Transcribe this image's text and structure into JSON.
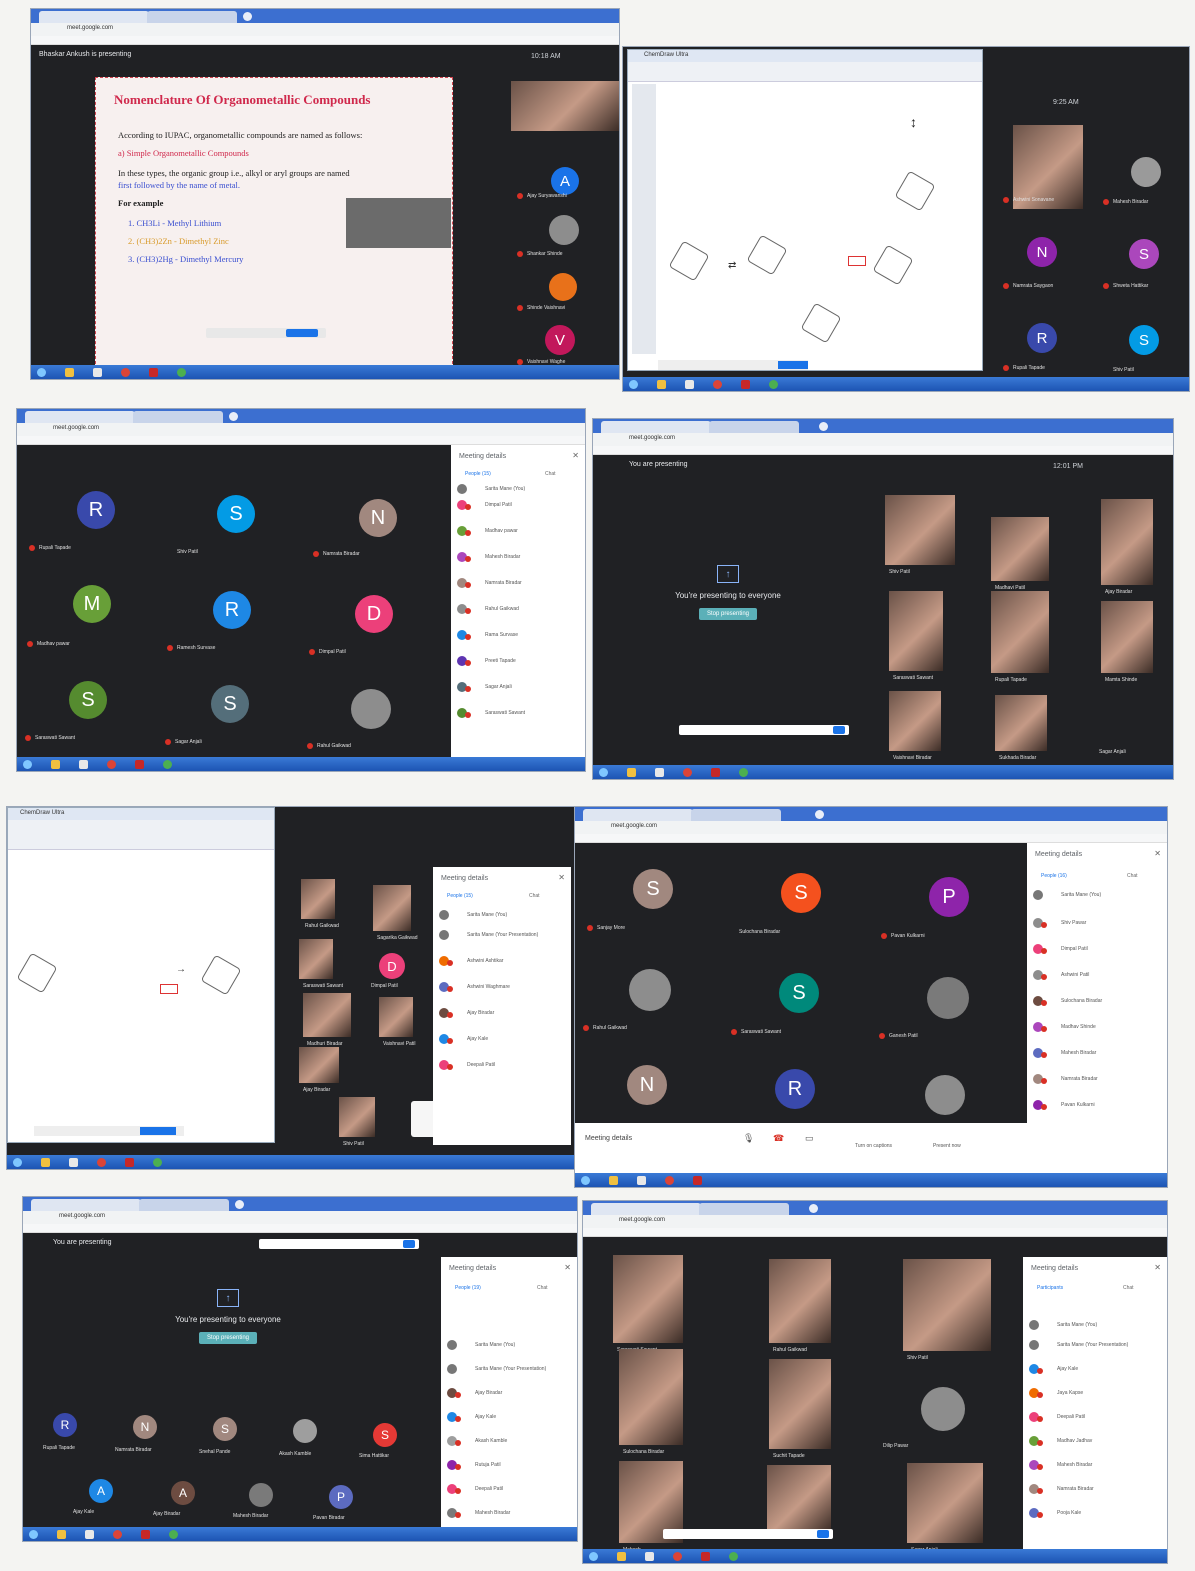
{
  "screens": [
    {
      "url": "meet.google.com",
      "banner": "Bhaskar Ankush is presenting",
      "clock": "10:18 AM",
      "slide": {
        "title": "Nomenclature Of Organometallic Compounds",
        "line1": "According to IUPAC, organometallic compounds are named as follows:",
        "line2": "a) Simple Organometallic Compounds",
        "line3": "In these types, the organic group i.e., alkyl or aryl groups are named",
        "line4": "first followed by the name of metal.",
        "line5": "For example",
        "ex1": "1.  CH3Li   - Methyl Lithium",
        "ex2": "2.  (CH3)2Zn  - Dimethyl Zinc",
        "ex3": "3.  (CH3)2Hg  - Dimethyl Mercury"
      },
      "participants": [
        {
          "letter": "A",
          "name": "Ajay Suryawanshi",
          "color": "#1a73e8"
        },
        {
          "letter": "",
          "name": "Shankar Shinde",
          "color": "#8d8d8d"
        },
        {
          "letter": "",
          "name": "Shinde Vaishnavi",
          "color": "#e8711a"
        },
        {
          "letter": "V",
          "name": "Vaishnavi Waghe",
          "color": "#c2185b"
        }
      ]
    },
    {
      "clock": "9:25 AM",
      "app_title": "ChemDraw Ultra",
      "participants": [
        {
          "letter": "",
          "name": "Ashwini Sonavane",
          "color": "#7a5a48"
        },
        {
          "letter": "",
          "name": "Mahesh Biradar",
          "color": "#9a9a9a"
        },
        {
          "letter": "N",
          "name": "Namrata Saygaon",
          "color": "#8e24aa"
        },
        {
          "letter": "S",
          "name": "Shweta Hattikar",
          "color": "#ab47bc"
        },
        {
          "letter": "R",
          "name": "Rupali Tapade",
          "color": "#3949ab"
        },
        {
          "letter": "S",
          "name": "Shiv Patil",
          "color": "#039be5"
        }
      ]
    },
    {
      "url": "meet.google.com",
      "panel_title": "Meeting details",
      "people_tab": "People (15)",
      "chat_tab": "Chat",
      "grid": [
        {
          "letter": "R",
          "name": "Rupali Tapade",
          "color": "#3949ab"
        },
        {
          "letter": "S",
          "name": "Shiv Patil",
          "color": "#039be5"
        },
        {
          "letter": "N",
          "name": "Namrata Biradar",
          "color": "#a1887f"
        },
        {
          "letter": "M",
          "name": "Madhav pawar",
          "color": "#689f38"
        },
        {
          "letter": "R",
          "name": "Ramesh Survase",
          "color": "#1e88e5"
        },
        {
          "letter": "D",
          "name": "Dimpal Patil",
          "color": "#ec407a"
        },
        {
          "letter": "S",
          "name": "Saraswati Sawant",
          "color": "#558b2f"
        },
        {
          "letter": "S",
          "name": "Sagar Anjali",
          "color": "#546e7a"
        },
        {
          "letter": "",
          "name": "Rahul Gaikwad",
          "color": "#8d8d8d"
        }
      ],
      "list": [
        "Sarita Mane (You)",
        "Dimpal Patil",
        "Madhav pawar",
        "Mahesh Biradar",
        "Namrata Biradar",
        "Rahul Gaikwad",
        "Rama Survase",
        "Preeti Tapade",
        "Sagar Anjali",
        "Saraswati Sawant"
      ]
    },
    {
      "url": "meet.google.com",
      "banner": "You are presenting",
      "clock": "12:01 PM",
      "present_text": "You're presenting to everyone",
      "stop_label": "Stop presenting",
      "names": [
        "Shiv Patil",
        "Madhavi Patil",
        "Ajay Biradar",
        "Saraswati Sawant",
        "Rupali Tapade",
        "Mamta Shinde",
        "Vaishnavi Biradar",
        "Sukhada Biradar",
        "Sagar Anjali"
      ]
    },
    {
      "app_title": "ChemDraw Ultra",
      "panel_title": "Meeting details",
      "people_tab": "People (15)",
      "chat_tab": "Chat",
      "names": [
        "Rahul Gaikwad",
        "Sagarika Gaikwad",
        "Saraswati Sawant",
        "Dimpal Patil",
        "Madhuri Biradar",
        "Vaishnavi Patil",
        "Ajay Biradar",
        "Shiv Patil"
      ],
      "list": [
        "Sarita Mane (You)",
        "Sarita Mane (Your Presentation)",
        "Ashwini Ashtikar",
        "Ashwini Waghmare",
        "Ajay Biradar",
        "Ajay Kale",
        "Deepali Patil"
      ]
    },
    {
      "url": "meet.google.com",
      "panel_title": "Meeting details",
      "people_tab": "People (16)",
      "chat_tab": "Chat",
      "meeting_details_label": "Meeting details",
      "captions_label": "Turn on captions",
      "present_label": "Present now",
      "grid": [
        {
          "letter": "S",
          "name": "Sanjay More",
          "color": "#a1887f"
        },
        {
          "letter": "S",
          "name": "Sulochana Biradar",
          "color": "#f4511e"
        },
        {
          "letter": "P",
          "name": "Pavan Kulkarni",
          "color": "#8e24aa"
        },
        {
          "letter": "",
          "name": "Rahul Gaikwad",
          "color": "#8d8d8d"
        },
        {
          "letter": "S",
          "name": "Saraswati Sawant",
          "color": "#00897b"
        },
        {
          "letter": "",
          "name": "Ganesh Patil",
          "color": "#7a7a7a"
        },
        {
          "letter": "N",
          "name": "",
          "color": "#a1887f"
        },
        {
          "letter": "R",
          "name": "",
          "color": "#3949ab"
        },
        {
          "letter": "",
          "name": "",
          "color": "#8d8d8d"
        }
      ],
      "list": [
        "Sarita Mane (You)",
        "Shiv Pawar",
        "Dimpal Patil",
        "Ashwini Patil",
        "Sulochana Biradar",
        "Madhav Shinde",
        "Mahesh Biradar",
        "Namrata Biradar",
        "Pavan Kulkarni"
      ]
    },
    {
      "url": "meet.google.com",
      "banner": "You are presenting",
      "present_text": "You're presenting to everyone",
      "stop_label": "Stop presenting",
      "panel_title": "Meeting details",
      "people_tab": "People (19)",
      "chat_tab": "Chat",
      "row1": [
        {
          "letter": "R",
          "name": "Rupali Tapade",
          "color": "#3949ab"
        },
        {
          "letter": "N",
          "name": "Namrata Biradar",
          "color": "#a1887f"
        },
        {
          "letter": "S",
          "name": "Snehal Pande",
          "color": "#a1887f"
        },
        {
          "letter": "",
          "name": "Akash Kamble",
          "color": "#9e9e9e"
        },
        {
          "letter": "S",
          "name": "Sima Hattikar",
          "color": "#e53935"
        }
      ],
      "row2": [
        {
          "letter": "A",
          "name": "Ajay Kale",
          "color": "#1e88e5"
        },
        {
          "letter": "A",
          "name": "Ajay Biradar",
          "color": "#6d4c41"
        },
        {
          "letter": "",
          "name": "Mahesh Biradar",
          "color": "#7a7a7a"
        },
        {
          "letter": "P",
          "name": "Pavan Biradar",
          "color": "#5c6bc0"
        }
      ],
      "list": [
        "Sarita Mane (You)",
        "Sarita Mane (Your Presentation)",
        "Ajay Biradar",
        "Ajay Kale",
        "Akash Kamble",
        "Rutuja Patil",
        "Deepali Patil",
        "Mahesh Biradar"
      ]
    },
    {
      "url": "meet.google.com",
      "panel_title": "Meeting details",
      "people_tab": "Participants",
      "chat_tab": "Chat",
      "names": [
        "Saraswati Sawant",
        "Rahul Gaikwad",
        "Shiv Patil",
        "Sulochana Biradar",
        "Suchit Tapade",
        "Dilip Pawar",
        "Mahesh",
        "Sagar Anjali"
      ],
      "list": [
        "Sarita Mane (You)",
        "Sarita Mane (Your Presentation)",
        "Ajay Kale",
        "Jaya Kapse",
        "Deepali Patil",
        "Madhav Jadhav",
        "Mahesh Biradar",
        "Namrata Biradar",
        "Pooja Kale"
      ]
    }
  ]
}
